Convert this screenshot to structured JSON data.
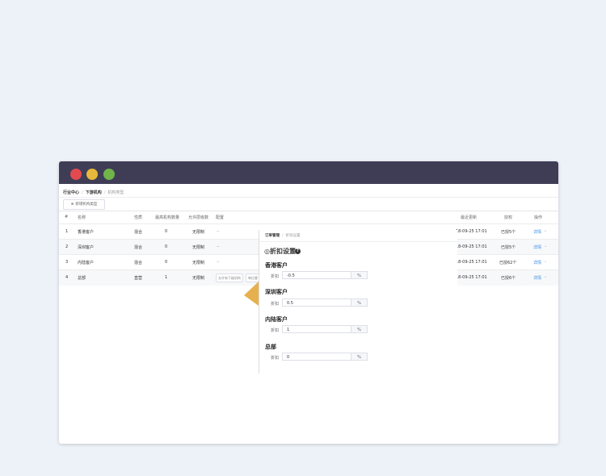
{
  "window": {
    "controls": {
      "close_color": "#e24a4f",
      "minimize_color": "#e6b93c",
      "maximize_color": "#70b44a"
    }
  },
  "breadcrumb": {
    "item1": "行业中心",
    "item2": "下游机构",
    "item3": "机构类型",
    "separator": "/"
  },
  "toolbar": {
    "add_icon": "plus-icon",
    "add_label": "新增机构类型"
  },
  "table": {
    "headers": {
      "index": "#",
      "name": "名称",
      "nature": "性质",
      "max_count": "最高机构数量",
      "allowed_level": "允许层级数",
      "config": "配置",
      "last_update": "最近更新",
      "permission": "授权",
      "actions": "操作"
    },
    "rows": [
      {
        "index": "1",
        "name": "香港客户",
        "nature": "混合",
        "max_count": "0",
        "allowed_level": "无限制",
        "config": "--",
        "last_update": "18-09-25 17:01",
        "permission": "已授5个",
        "action": "详情"
      },
      {
        "index": "2",
        "name": "深圳客户",
        "nature": "混合",
        "max_count": "0",
        "allowed_level": "无限制",
        "config": "--",
        "last_update": "18-09-25 17:01",
        "permission": "已授5个",
        "action": "详情"
      },
      {
        "index": "3",
        "name": "内陆客户",
        "nature": "混合",
        "max_count": "0",
        "allowed_level": "无限制",
        "config": "--",
        "last_update": "18-09-25 17:01",
        "permission": "已授62个",
        "action": "详情"
      },
      {
        "index": "4",
        "name": "总部",
        "nature": "直营",
        "max_count": "1",
        "allowed_level": "无限制",
        "config_chip1": "允许有下级机构",
        "config_chip2": "每位客",
        "last_update": "18-09-25 17:01",
        "permission": "已授6个",
        "action": "详情"
      }
    ]
  },
  "popup": {
    "breadcrumb": {
      "item1": "订单管理",
      "item2": "折扣设置",
      "separator": "/"
    },
    "title": "◎折扣设置",
    "help_icon": "question-icon",
    "help_glyph": "?",
    "sections": [
      {
        "title": "香港客户",
        "label": "折扣",
        "value": "-0.5",
        "unit": "%"
      },
      {
        "title": "深圳客户",
        "label": "折扣",
        "value": "0.5",
        "unit": "%"
      },
      {
        "title": "内陆客户",
        "label": "折扣",
        "value": "1",
        "unit": "%"
      },
      {
        "title": "总部",
        "label": "折扣",
        "value": "0",
        "unit": "%"
      }
    ]
  },
  "colors": {
    "background": "#edf2f8",
    "titlebar": "#3f3d55",
    "link": "#3a8ee6",
    "arrow": "#e7b04f"
  }
}
